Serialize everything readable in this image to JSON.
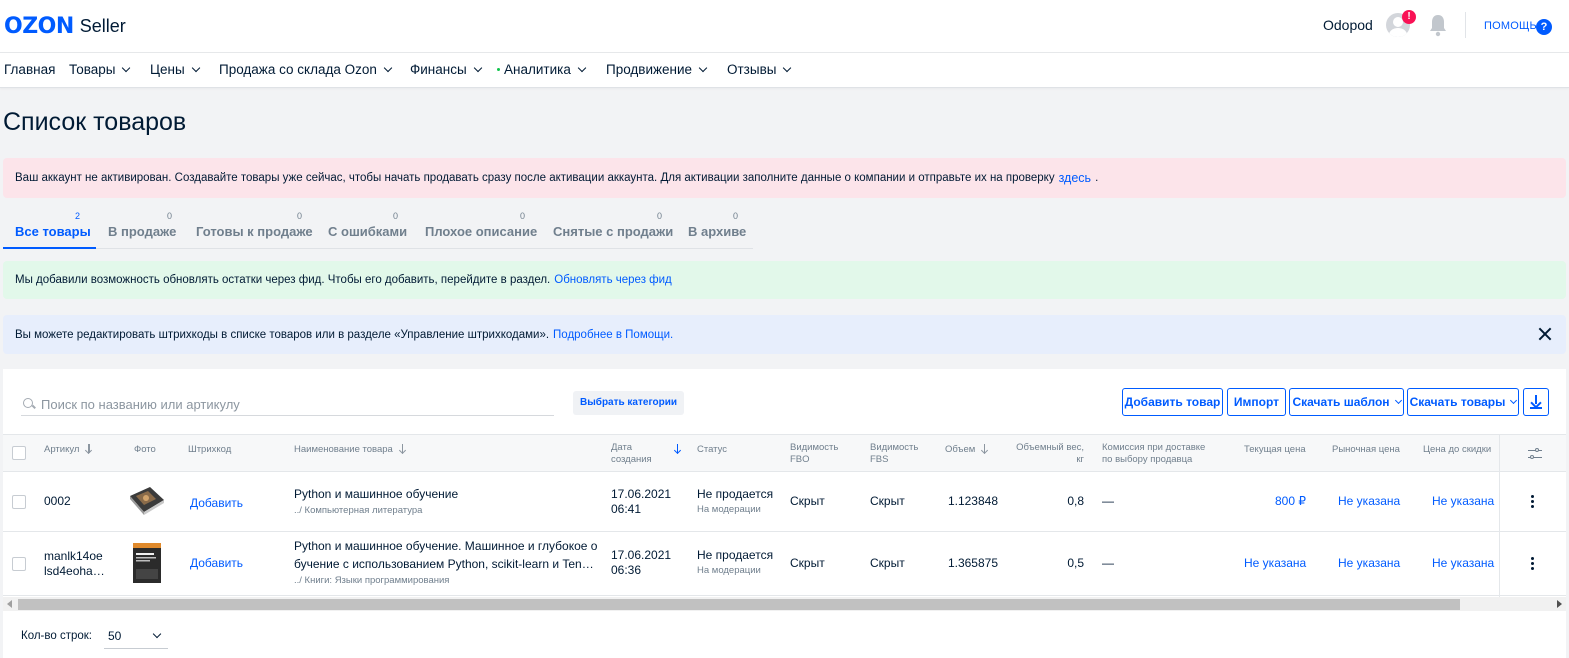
{
  "header": {
    "logo_brand": "OZON",
    "logo_product": "Seller",
    "user_name": "Odopod",
    "notification_badge": "!",
    "help_label": "помощь",
    "help_icon": "?"
  },
  "nav": {
    "items": [
      {
        "label": "Главная",
        "has_dropdown": false
      },
      {
        "label": "Товары",
        "has_dropdown": true
      },
      {
        "label": "Цены",
        "has_dropdown": true
      },
      {
        "label": "Продажа со склада Ozon",
        "has_dropdown": true
      },
      {
        "label": "Финансы",
        "has_dropdown": true
      },
      {
        "label": "Аналитика",
        "has_dropdown": true
      },
      {
        "label": "Продвижение",
        "has_dropdown": true
      },
      {
        "label": "Отзывы",
        "has_dropdown": true
      }
    ]
  },
  "page": {
    "title": "Список товаров"
  },
  "alerts": {
    "account": {
      "text": "Ваш аккаунт не активирован. Создавайте товары уже сейчас, чтобы начать продавать сразу после активации аккаунта. Для активации заполните данные о компании и отправьте их на проверку",
      "link": "здесь",
      "suffix": "."
    },
    "feed": {
      "text": "Мы добавили возможность обновлять остатки через фид. Чтобы его добавить, перейдите в раздел.",
      "link": "Обновлять через фид"
    },
    "barcodes": {
      "text": "Вы можете редактировать штрихкоды в списке товаров или в разделе «Управление штрихкодами».",
      "link": "Подробнее в Помощи."
    }
  },
  "tabs": [
    {
      "label": "Все товары",
      "count": "2",
      "active": true
    },
    {
      "label": "В продаже",
      "count": "0",
      "active": false
    },
    {
      "label": "Готовы к продаже",
      "count": "0",
      "active": false
    },
    {
      "label": "С ошибками",
      "count": "0",
      "active": false
    },
    {
      "label": "Плохое описание",
      "count": "0",
      "active": false
    },
    {
      "label": "Снятые с продажи",
      "count": "0",
      "active": false
    },
    {
      "label": "В архиве",
      "count": "0",
      "active": false
    }
  ],
  "toolbar": {
    "search_placeholder": "Поиск по названию или артикулу",
    "search_value": "",
    "categories_button": "Выбрать категории",
    "add_product": "Добавить товар",
    "import": "Импорт",
    "download_template": "Скачать шаблон",
    "download_products": "Скачать товары"
  },
  "table": {
    "columns": {
      "article": "Артикул",
      "photo": "Фото",
      "barcode": "Штрихкод",
      "name": "Наименование товара",
      "created_1": "Дата",
      "created_2": "создания",
      "status": "Статус",
      "fbo_1": "Видимость",
      "fbo_2": "FBO",
      "fbs_1": "Видимость",
      "fbs_2": "FBS",
      "volume": "Объем",
      "volweight_1": "Объемный вес,",
      "volweight_2": "кг",
      "commission_1": "Комиссия при доставке",
      "commission_2": "по выбору продавца",
      "current_price": "Текущая цена",
      "market_price": "Рыночная цена",
      "price_before": "Цена до скидки"
    },
    "rows": [
      {
        "article_1": "0002",
        "article_2": "",
        "barcode": "Добавить",
        "name_1": "Python и машинное обучение",
        "name_2": "",
        "category": "../ Компьютерная литература",
        "date": "17.06.2021",
        "time": "06:41",
        "status": "Не продается",
        "status_sub": "На модерации",
        "fbo": "Скрыт",
        "fbs": "Скрыт",
        "volume": "1.123848",
        "volweight": "0,8",
        "commission": "—",
        "current_price": "800 ₽",
        "market_price": "Не указана",
        "price_before": "Не указана"
      },
      {
        "article_1": "manlk14oe",
        "article_2": "lsd4eoha…",
        "barcode": "Добавить",
        "name_1": "Python и машинное обучение. Машинное и глубокое о",
        "name_2": "бучение с использованием Python, scikit-learn и Ten…",
        "category": "../ Книги: Языки программирования",
        "date": "17.06.2021",
        "time": "06:36",
        "status": "Не продается",
        "status_sub": "На модерации",
        "fbo": "Скрыт",
        "fbs": "Скрыт",
        "volume": "1.365875",
        "volweight": "0,5",
        "commission": "—",
        "current_price": "Не указана",
        "market_price": "Не указана",
        "price_before": "Не указана"
      }
    ]
  },
  "pagination": {
    "rows_label": "Кол-во строк:",
    "rows_value": "50"
  },
  "colors": {
    "brand": "#005bff",
    "alert_red": "#fce4ea",
    "alert_green": "#e2f8ea",
    "alert_blue": "#e7eefc",
    "badge": "#f91155"
  }
}
